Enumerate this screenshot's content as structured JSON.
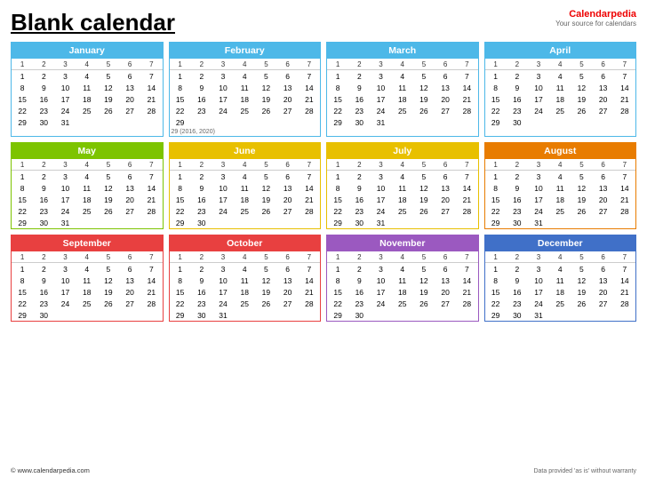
{
  "title": "Blank calendar",
  "brand": {
    "name1": "Calendar",
    "name2": "pedia",
    "tagline": "Your source for calendars"
  },
  "months": [
    {
      "key": "jan",
      "name": "January",
      "days": [
        [
          "1",
          "2",
          "3",
          "4",
          "5",
          "6",
          "7"
        ],
        [
          "8",
          "9",
          "10",
          "11",
          "12",
          "13",
          "14"
        ],
        [
          "15",
          "16",
          "17",
          "18",
          "19",
          "20",
          "21"
        ],
        [
          "22",
          "23",
          "24",
          "25",
          "26",
          "27",
          "28"
        ],
        [
          "29",
          "30",
          "31",
          "",
          "",
          "",
          ""
        ]
      ]
    },
    {
      "key": "feb",
      "name": "February",
      "days": [
        [
          "1",
          "2",
          "3",
          "4",
          "5",
          "6",
          "7"
        ],
        [
          "8",
          "9",
          "10",
          "11",
          "12",
          "13",
          "14"
        ],
        [
          "15",
          "16",
          "17",
          "18",
          "19",
          "20",
          "21"
        ],
        [
          "22",
          "23",
          "24",
          "25",
          "26",
          "27",
          "28"
        ],
        [
          "29",
          "",
          "",
          "",
          "",
          "",
          ""
        ]
      ],
      "note": "29 (2016, 2020)"
    },
    {
      "key": "mar",
      "name": "March",
      "days": [
        [
          "1",
          "2",
          "3",
          "4",
          "5",
          "6",
          "7"
        ],
        [
          "8",
          "9",
          "10",
          "11",
          "12",
          "13",
          "14"
        ],
        [
          "15",
          "16",
          "17",
          "18",
          "19",
          "20",
          "21"
        ],
        [
          "22",
          "23",
          "24",
          "25",
          "26",
          "27",
          "28"
        ],
        [
          "29",
          "30",
          "31",
          "",
          "",
          "",
          ""
        ]
      ]
    },
    {
      "key": "apr",
      "name": "April",
      "days": [
        [
          "1",
          "2",
          "3",
          "4",
          "5",
          "6",
          "7"
        ],
        [
          "8",
          "9",
          "10",
          "11",
          "12",
          "13",
          "14"
        ],
        [
          "15",
          "16",
          "17",
          "18",
          "19",
          "20",
          "21"
        ],
        [
          "22",
          "23",
          "24",
          "25",
          "26",
          "27",
          "28"
        ],
        [
          "29",
          "30",
          "",
          "",
          "",
          "",
          ""
        ]
      ]
    },
    {
      "key": "may",
      "name": "May",
      "days": [
        [
          "1",
          "2",
          "3",
          "4",
          "5",
          "6",
          "7"
        ],
        [
          "8",
          "9",
          "10",
          "11",
          "12",
          "13",
          "14"
        ],
        [
          "15",
          "16",
          "17",
          "18",
          "19",
          "20",
          "21"
        ],
        [
          "22",
          "23",
          "24",
          "25",
          "26",
          "27",
          "28"
        ],
        [
          "29",
          "30",
          "31",
          "",
          "",
          "",
          ""
        ]
      ]
    },
    {
      "key": "jun",
      "name": "June",
      "days": [
        [
          "1",
          "2",
          "3",
          "4",
          "5",
          "6",
          "7"
        ],
        [
          "8",
          "9",
          "10",
          "11",
          "12",
          "13",
          "14"
        ],
        [
          "15",
          "16",
          "17",
          "18",
          "19",
          "20",
          "21"
        ],
        [
          "22",
          "23",
          "24",
          "25",
          "26",
          "27",
          "28"
        ],
        [
          "29",
          "30",
          "",
          "",
          "",
          "",
          ""
        ]
      ]
    },
    {
      "key": "jul",
      "name": "July",
      "days": [
        [
          "1",
          "2",
          "3",
          "4",
          "5",
          "6",
          "7"
        ],
        [
          "8",
          "9",
          "10",
          "11",
          "12",
          "13",
          "14"
        ],
        [
          "15",
          "16",
          "17",
          "18",
          "19",
          "20",
          "21"
        ],
        [
          "22",
          "23",
          "24",
          "25",
          "26",
          "27",
          "28"
        ],
        [
          "29",
          "30",
          "31",
          "",
          "",
          "",
          ""
        ]
      ]
    },
    {
      "key": "aug",
      "name": "August",
      "days": [
        [
          "1",
          "2",
          "3",
          "4",
          "5",
          "6",
          "7"
        ],
        [
          "8",
          "9",
          "10",
          "11",
          "12",
          "13",
          "14"
        ],
        [
          "15",
          "16",
          "17",
          "18",
          "19",
          "20",
          "21"
        ],
        [
          "22",
          "23",
          "24",
          "25",
          "26",
          "27",
          "28"
        ],
        [
          "29",
          "30",
          "31",
          "",
          "",
          "",
          ""
        ]
      ]
    },
    {
      "key": "sep",
      "name": "September",
      "days": [
        [
          "1",
          "2",
          "3",
          "4",
          "5",
          "6",
          "7"
        ],
        [
          "8",
          "9",
          "10",
          "11",
          "12",
          "13",
          "14"
        ],
        [
          "15",
          "16",
          "17",
          "18",
          "19",
          "20",
          "21"
        ],
        [
          "22",
          "23",
          "24",
          "25",
          "26",
          "27",
          "28"
        ],
        [
          "29",
          "30",
          "",
          "",
          "",
          "",
          ""
        ]
      ]
    },
    {
      "key": "oct",
      "name": "October",
      "days": [
        [
          "1",
          "2",
          "3",
          "4",
          "5",
          "6",
          "7"
        ],
        [
          "8",
          "9",
          "10",
          "11",
          "12",
          "13",
          "14"
        ],
        [
          "15",
          "16",
          "17",
          "18",
          "19",
          "20",
          "21"
        ],
        [
          "22",
          "23",
          "24",
          "25",
          "26",
          "27",
          "28"
        ],
        [
          "29",
          "30",
          "31",
          "",
          "",
          "",
          ""
        ]
      ]
    },
    {
      "key": "nov",
      "name": "November",
      "days": [
        [
          "1",
          "2",
          "3",
          "4",
          "5",
          "6",
          "7"
        ],
        [
          "8",
          "9",
          "10",
          "11",
          "12",
          "13",
          "14"
        ],
        [
          "15",
          "16",
          "17",
          "18",
          "19",
          "20",
          "21"
        ],
        [
          "22",
          "23",
          "24",
          "25",
          "26",
          "27",
          "28"
        ],
        [
          "29",
          "30",
          "",
          "",
          "",
          "",
          ""
        ]
      ]
    },
    {
      "key": "dec",
      "name": "December",
      "days": [
        [
          "1",
          "2",
          "3",
          "4",
          "5",
          "6",
          "7"
        ],
        [
          "8",
          "9",
          "10",
          "11",
          "12",
          "13",
          "14"
        ],
        [
          "15",
          "16",
          "17",
          "18",
          "19",
          "20",
          "21"
        ],
        [
          "22",
          "23",
          "24",
          "25",
          "26",
          "27",
          "28"
        ],
        [
          "29",
          "30",
          "31",
          "",
          "",
          "",
          ""
        ]
      ]
    }
  ],
  "dow": [
    "1",
    "2",
    "3",
    "4",
    "5",
    "6",
    "7"
  ],
  "footer_left": "© www.calendarpedia.com",
  "footer_right": "Data provided 'as is' without warranty"
}
